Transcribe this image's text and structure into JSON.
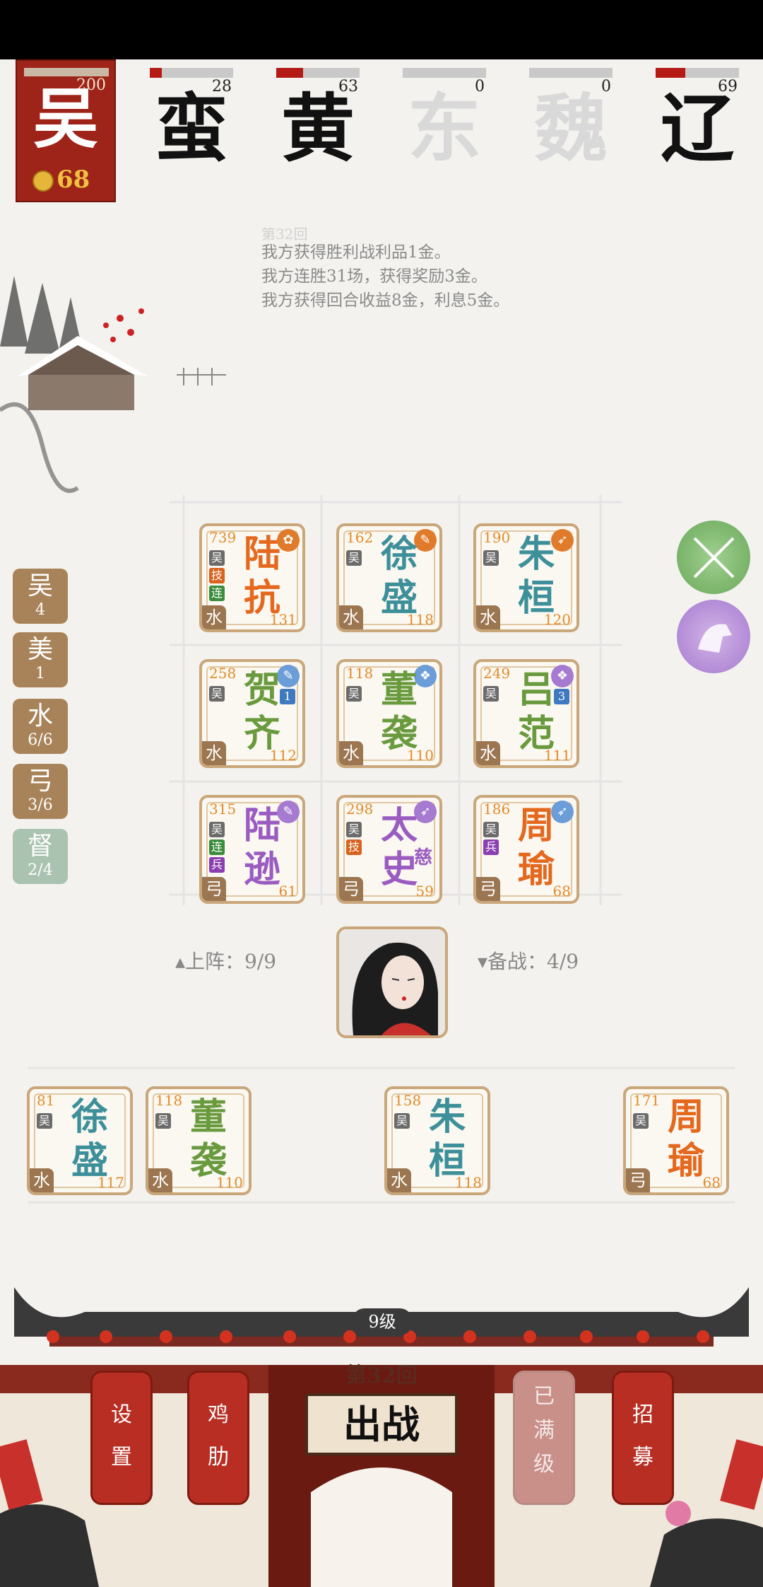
{
  "player_faction": {
    "name": "吴",
    "hp": "200",
    "gold": "68"
  },
  "factions": [
    {
      "name": "蛮",
      "hp": "28",
      "hp_ratio": 0.14,
      "alive": true
    },
    {
      "name": "黄",
      "hp": "63",
      "hp_ratio": 0.32,
      "alive": true
    },
    {
      "name": "东",
      "hp": "0",
      "hp_ratio": 0,
      "alive": false
    },
    {
      "name": "魏",
      "hp": "0",
      "hp_ratio": 0,
      "alive": false
    },
    {
      "name": "辽",
      "hp": "69",
      "hp_ratio": 0.35,
      "alive": true
    }
  ],
  "log": {
    "header": "第32回",
    "lines": [
      "我方获得胜利战利品1金。",
      "我方连胜31场，获得奖励3金。",
      "我方获得回合收益8金，利息5金。"
    ]
  },
  "synergies": [
    {
      "title": "吴",
      "value": "4"
    },
    {
      "title": "美",
      "value": "1"
    },
    {
      "title": "水",
      "value": "6/6"
    },
    {
      "title": "弓",
      "value": "3/6"
    },
    {
      "title": "督",
      "value": "2/4"
    }
  ],
  "board": [
    {
      "cost": "739",
      "n1": "陆",
      "n2": "抗",
      "type": "水",
      "lvl": "131",
      "color": "orange",
      "tags": [
        "吴",
        "技",
        "连"
      ]
    },
    {
      "cost": "162",
      "n1": "徐",
      "n2": "盛",
      "type": "水",
      "lvl": "118",
      "color": "teal",
      "tags": [
        "吴"
      ]
    },
    {
      "cost": "190",
      "n1": "朱",
      "n2": "桓",
      "type": "水",
      "lvl": "120",
      "color": "teal",
      "tags": [
        "吴"
      ]
    },
    {
      "cost": "258",
      "n1": "贺",
      "n2": "齐",
      "type": "水",
      "lvl": "112",
      "color": "green",
      "tags": [
        "吴"
      ],
      "badge": "1"
    },
    {
      "cost": "118",
      "n1": "董",
      "n2": "袭",
      "type": "水",
      "lvl": "110",
      "color": "green",
      "tags": [
        "吴"
      ]
    },
    {
      "cost": "249",
      "n1": "吕",
      "n2": "范",
      "type": "水",
      "lvl": "111",
      "color": "green",
      "tags": [
        "吴"
      ],
      "badge": "3"
    },
    {
      "cost": "315",
      "n1": "陆",
      "n2": "逊",
      "type": "弓",
      "lvl": "61",
      "color": "purple",
      "tags": [
        "吴",
        "连",
        "兵"
      ]
    },
    {
      "cost": "298",
      "n1": "太",
      "n2": "史",
      "n3": "慈",
      "type": "弓",
      "lvl": "59",
      "color": "purple",
      "tags": [
        "吴",
        "技"
      ]
    },
    {
      "cost": "186",
      "n1": "周",
      "n2": "瑜",
      "type": "弓",
      "lvl": "68",
      "color": "orange",
      "tags": [
        "吴",
        "兵"
      ]
    }
  ],
  "deploy": {
    "on_field": "▴上阵：9/9",
    "bench": "▾备战：4/9"
  },
  "bench": [
    {
      "cost": "81",
      "n1": "徐",
      "n2": "盛",
      "type": "水",
      "lvl": "117",
      "color": "teal",
      "tags": [
        "吴"
      ]
    },
    {
      "cost": "118",
      "n1": "董",
      "n2": "袭",
      "type": "水",
      "lvl": "110",
      "color": "green",
      "tags": [
        "吴"
      ]
    },
    {
      "cost": "158",
      "n1": "朱",
      "n2": "桓",
      "type": "水",
      "lvl": "118",
      "color": "teal",
      "tags": [
        "吴"
      ]
    },
    {
      "cost": "171",
      "n1": "周",
      "n2": "瑜",
      "type": "弓",
      "lvl": "68",
      "color": "orange",
      "tags": [
        "吴"
      ]
    }
  ],
  "footer": {
    "level": "9级",
    "round": "第32回",
    "battle": "出战",
    "settings": [
      "设",
      "置"
    ],
    "chicken_rib": [
      "鸡",
      "肋"
    ],
    "max_level": [
      "已",
      "满",
      "级"
    ],
    "recruit": [
      "招",
      "募"
    ]
  }
}
